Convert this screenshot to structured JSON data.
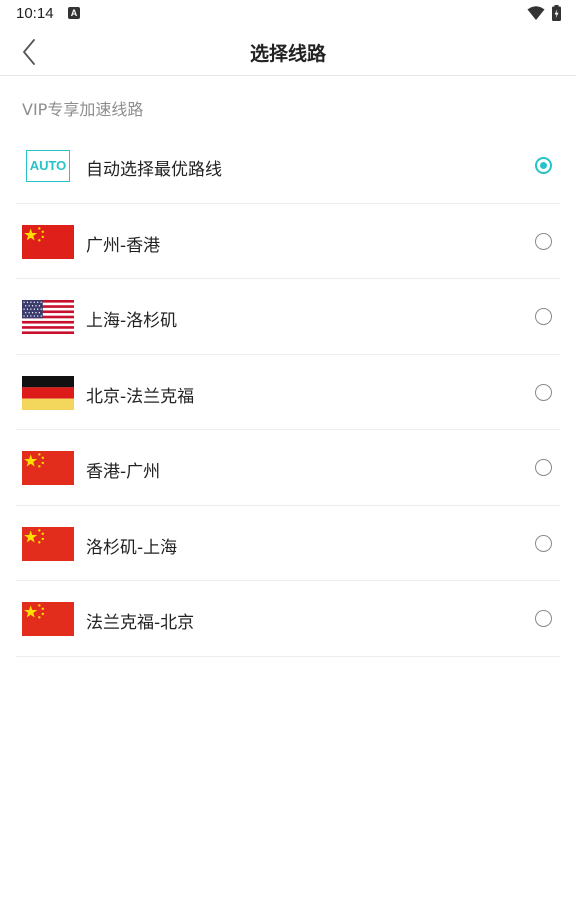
{
  "status_bar": {
    "time": "10:14",
    "notification_icon": "a-icon",
    "wifi_icon": "wifi-icon",
    "battery_icon": "battery-charging-icon"
  },
  "header": {
    "back_icon": "chevron-left-icon",
    "title": "选择线路"
  },
  "section": {
    "label": "VIP专享加速线路"
  },
  "accent_color": "#27c3c9",
  "routes": [
    {
      "label": "自动选择最优路线",
      "icon": "auto-icon",
      "badge_text": "AUTO",
      "selected": true
    },
    {
      "label": "广州-香港",
      "icon": "china-flag-icon",
      "selected": false
    },
    {
      "label": "上海-洛杉矶",
      "icon": "us-flag-icon",
      "selected": false
    },
    {
      "label": "北京-法兰克福",
      "icon": "germany-flag-icon",
      "selected": false
    },
    {
      "label": "香港-广州",
      "icon": "china-flag-icon",
      "selected": false
    },
    {
      "label": "洛杉矶-上海",
      "icon": "china-flag-icon",
      "selected": false
    },
    {
      "label": "法兰克福-北京",
      "icon": "china-flag-icon",
      "selected": false
    }
  ]
}
